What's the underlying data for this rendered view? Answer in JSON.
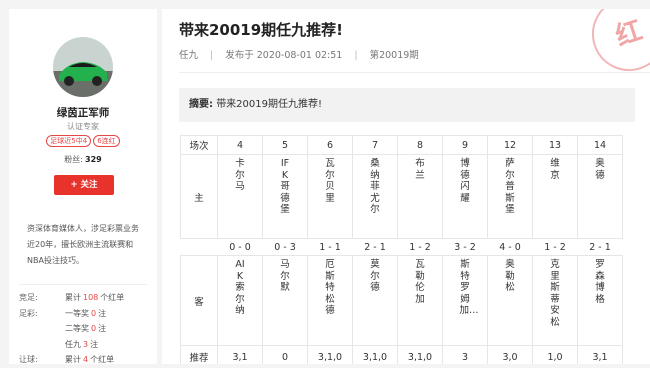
{
  "author": {
    "name": "绿茵正军师",
    "role": "认证专家",
    "badges": [
      "足球近5中4",
      "6连红"
    ],
    "fans_label": "粉丝:",
    "fans_count": "329",
    "follow_label": "+ 关注",
    "bio": "资深体育媒体人，涉足彩票业务近20年，擅长欧洲主流联赛和NBA投注技巧。"
  },
  "stats": [
    {
      "label": "竞足:",
      "prefix": "累计",
      "num": "108",
      "suffix": "个红单"
    },
    {
      "label": "足彩:",
      "prefix": "一等奖",
      "num": "0",
      "suffix": "注"
    },
    {
      "label": "",
      "prefix": "二等奖",
      "num": "0",
      "suffix": "注"
    },
    {
      "label": "",
      "prefix": "任九",
      "num": "3",
      "suffix": "注"
    },
    {
      "label": "让球:",
      "prefix": "累计",
      "num": "4",
      "suffix": "个红单"
    }
  ],
  "article": {
    "title": "带来20019期任九推荐!",
    "category": "任九",
    "published": "发布于 2020-08-01 02:51",
    "issue": "第20019期",
    "stamp": "红",
    "summary_label": "摘要:",
    "summary_text": "带来20019期任九推荐!"
  },
  "table": {
    "labels": {
      "match": "场次",
      "home": "主",
      "away": "客",
      "pick": "推荐"
    },
    "matches": [
      {
        "no": "4",
        "home": "卡尔马",
        "score": "0 - 0",
        "away": "AIK索尔纳",
        "pick": "3,1"
      },
      {
        "no": "5",
        "home": "IFK哥德堡",
        "score": "0 - 3",
        "away": "马尔默",
        "pick": "0"
      },
      {
        "no": "6",
        "home": "瓦尔贝里",
        "score": "1 - 1",
        "away": "厄斯特松德",
        "pick": "3,1,0"
      },
      {
        "no": "7",
        "home": "桑纳菲尤尔",
        "score": "2 - 1",
        "away": "莫尔德",
        "pick": "3,1,0"
      },
      {
        "no": "8",
        "home": "布兰",
        "score": "1 - 2",
        "away": "瓦勒伦加",
        "pick": "3,1,0"
      },
      {
        "no": "9",
        "home": "博德闪耀",
        "score": "3 - 2",
        "away": "斯特罗姆加…",
        "pick": "3"
      },
      {
        "no": "12",
        "home": "萨尔普斯堡",
        "score": "4 - 0",
        "away": "奥勒松",
        "pick": "3,0"
      },
      {
        "no": "13",
        "home": "维京",
        "score": "1 - 2",
        "away": "克里斯蒂安松",
        "pick": "1,0"
      },
      {
        "no": "14",
        "home": "奥德",
        "score": "2 - 1",
        "away": "罗森博格",
        "pick": "3,1"
      }
    ]
  }
}
